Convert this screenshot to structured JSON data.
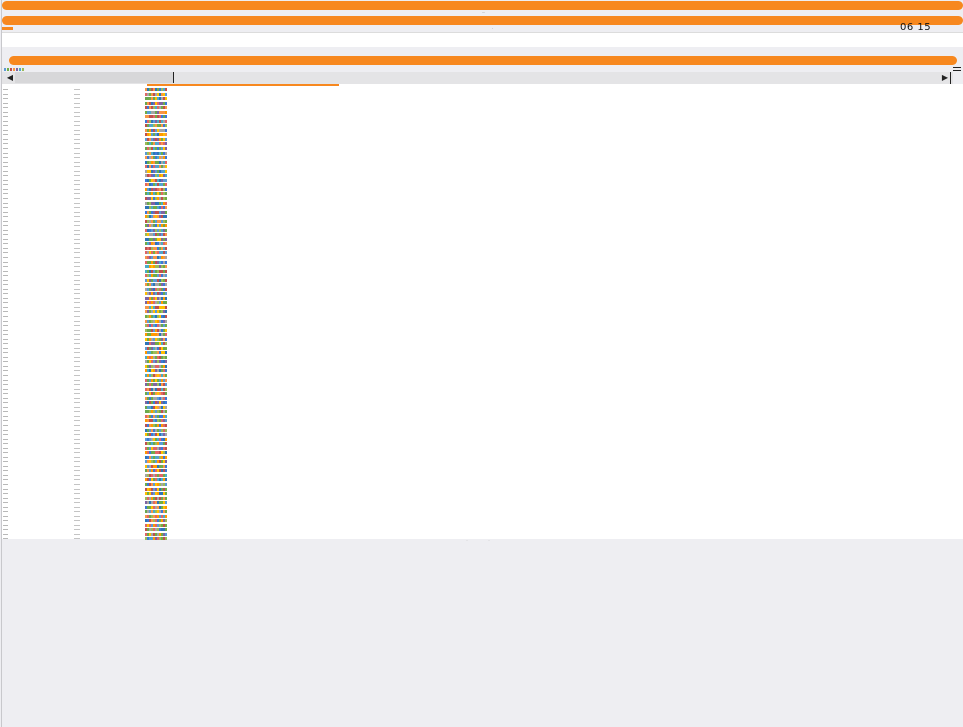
{
  "header": {
    "clock": "06 15",
    "tick_top": "—",
    "tick_mid": "-"
  },
  "legend": {
    "text": "· ··· ·· ·",
    "colors": [
      "#5b9bd5",
      "#70ad47",
      "#c0504d",
      "#f79646",
      "#8064a2",
      "#4bacc6",
      "#9bbb59"
    ]
  },
  "scrollbar": {
    "left_arrow": "◀",
    "right_arrow": "▶"
  },
  "table": {
    "row_count": 100,
    "cell_palette": [
      "#5b9bd5",
      "#70ad47",
      "#ffc000",
      "#c0504d",
      "#8064a2",
      "#4bacc6",
      "#f79646",
      "#2e75b6",
      "#9bbb59",
      "#a5a5a5",
      "#e06666",
      "#ff9900",
      "#3c78d8",
      "#6aa84f"
    ]
  },
  "pager": {
    "left": "—",
    "right": "—"
  },
  "colors": {
    "accent": "#f7881f",
    "panel": "#eeeef2"
  }
}
